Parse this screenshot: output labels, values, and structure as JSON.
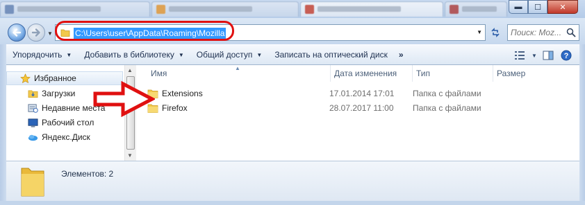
{
  "window": {
    "controls": {
      "minimize": "▬",
      "maximize": "☐",
      "close": "✕"
    }
  },
  "address": {
    "path": "C:\\Users\\user\\AppData\\Roaming\\Mozilla",
    "search_placeholder": "Поиск: Moz..."
  },
  "toolbar": {
    "organize": "Упорядочить",
    "add_to_library": "Добавить в библиотеку",
    "share": "Общий доступ",
    "burn": "Записать на оптический диск",
    "more": "»"
  },
  "sidebar": {
    "items": [
      {
        "label": "Избранное",
        "icon": "star-icon"
      },
      {
        "label": "Загрузки",
        "icon": "downloads-folder-icon"
      },
      {
        "label": "Недавние места",
        "icon": "recent-places-icon"
      },
      {
        "label": "Рабочий стол",
        "icon": "desktop-icon"
      },
      {
        "label": "Яндекс.Диск",
        "icon": "yandex-disk-icon"
      }
    ]
  },
  "columns": {
    "name": "Имя",
    "date": "Дата изменения",
    "type": "Тип",
    "size": "Размер"
  },
  "files": [
    {
      "name": "Extensions",
      "date": "17.01.2014 17:01",
      "type": "Папка с файлами",
      "size": ""
    },
    {
      "name": "Firefox",
      "date": "28.07.2017 11:00",
      "type": "Папка с файлами",
      "size": ""
    }
  ],
  "details": {
    "count": "Элементов: 2"
  },
  "colors": {
    "selection": "#3399ff",
    "annotation": "#e01010",
    "folder": "#f2c94c"
  }
}
